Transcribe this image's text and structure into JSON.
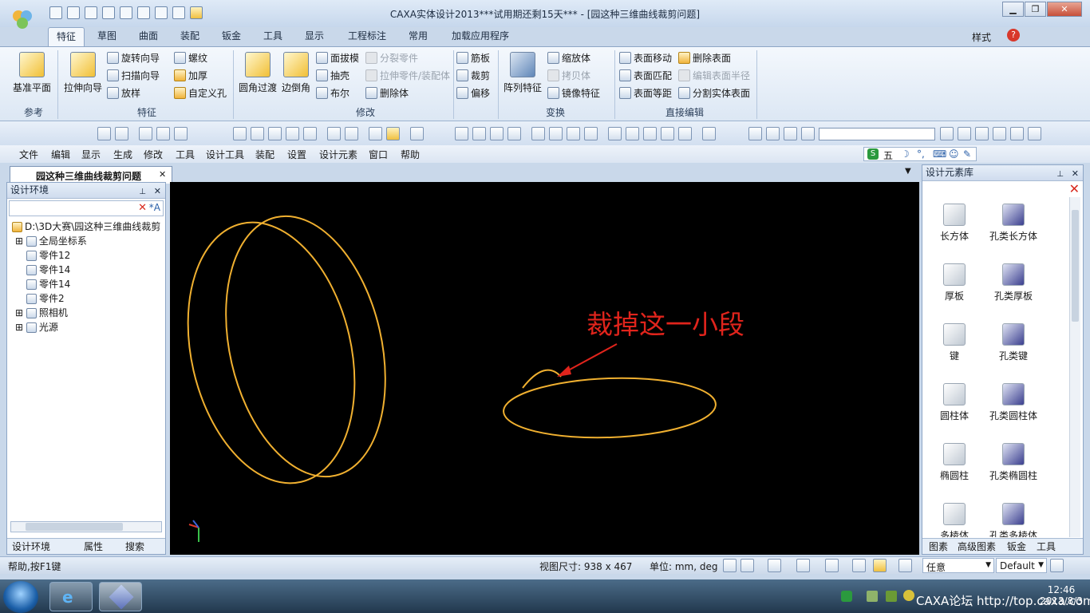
{
  "window": {
    "title": "CAXA实体设计2013***试用期还剩15天*** - [园这种三维曲线裁剪问题]",
    "style_label": "样式"
  },
  "ribbon_tabs": [
    "特征",
    "草图",
    "曲面",
    "装配",
    "钣金",
    "工具",
    "显示",
    "工程标注",
    "常用",
    "加载应用程序"
  ],
  "ribbon": {
    "ref_group": {
      "label": "参考",
      "plane": "基准平面"
    },
    "feature_group": {
      "label": "特征",
      "extrude": "拉伸向导",
      "revolve": "旋转向导",
      "sweep": "扫描向导",
      "loft": "放样",
      "thread": "螺纹",
      "thicken": "加厚",
      "custom_hole": "自定义孔"
    },
    "modify_group": {
      "label": "修改",
      "fillet": "圆角过渡",
      "chamfer": "边倒角",
      "draft": "面拔模",
      "shell": "抽壳",
      "boolean": "布尔",
      "split": "分裂零件",
      "extrude_to": "拉伸零件/装配体",
      "delete": "删除体"
    },
    "transform_group": {
      "label": "变换",
      "pattern": "阵列特征",
      "rib": "筋板",
      "trim": "裁剪",
      "offset": "偏移",
      "scale": "缩放体",
      "copy": "拷贝体",
      "mirror": "镜像特征"
    },
    "direct_group": {
      "label": "直接编辑",
      "move_face": "表面移动",
      "match_face": "表面匹配",
      "equidist": "表面等距",
      "delete_face": "删除表面",
      "edit_radius": "编辑表面半径",
      "split_face": "分割实体表面"
    }
  },
  "menubar": [
    "文件",
    "编辑",
    "显示",
    "生成",
    "修改",
    "工具",
    "设计工具",
    "装配",
    "设置",
    "设计元素",
    "窗口",
    "帮助"
  ],
  "ime": "五",
  "document_tab": "园这种三维曲线裁剪问题",
  "left_panel": {
    "title": "设计环境",
    "tree": [
      "D:\\3D大赛\\园这种三维曲线裁剪",
      "全局坐标系",
      "零件12",
      "零件14",
      "零件14",
      "零件2",
      "照相机",
      "光源"
    ],
    "tabs": [
      "设计环境",
      "属性",
      "搜索"
    ]
  },
  "viewport": {
    "annotation": "裁掉这一小段"
  },
  "right_panel": {
    "title": "设计元素库",
    "items": [
      "长方体",
      "孔类长方体",
      "厚板",
      "孔类厚板",
      "键",
      "孔类键",
      "圆柱体",
      "孔类圆柱体",
      "椭圆柱",
      "孔类椭圆柱",
      "多棱体",
      "孔类多棱体"
    ],
    "tabs": [
      "图素",
      "高级图素",
      "钣金",
      "工具"
    ]
  },
  "status": {
    "help": "帮助,按F1键",
    "view_size": "视图尺寸: 938 x 467",
    "units": "单位: mm, deg",
    "filter": "任意",
    "style": "Default"
  },
  "taskbar": {
    "time": "12:46",
    "date": "2013/8/3",
    "watermark": "CAXA论坛 http://top.caxa.com/"
  },
  "colors": {
    "curve": "#f0b030",
    "annotation": "#e0241c",
    "viewport_bg": "#000000"
  }
}
